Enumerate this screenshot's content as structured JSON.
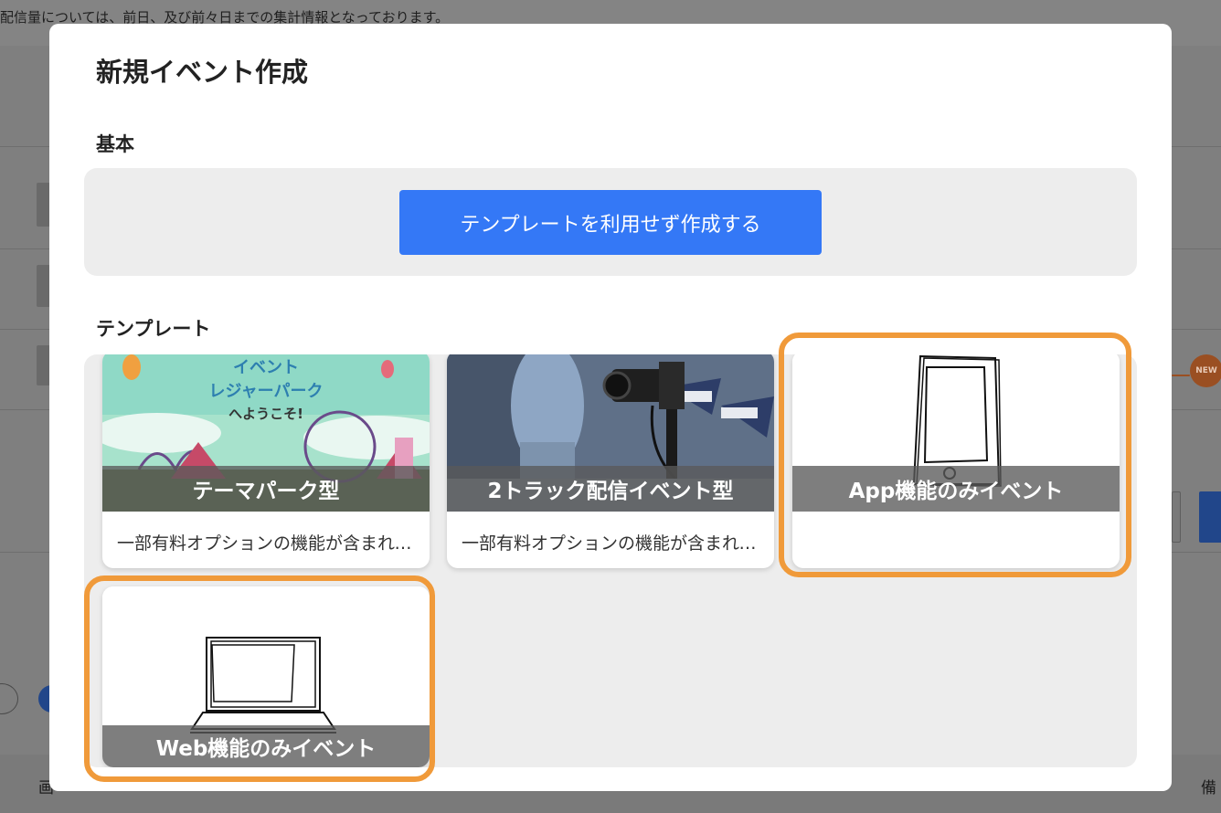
{
  "background": {
    "notice_text": "配信量については、前日、及び前々日までの集計情報となっております。",
    "new_badge": "NEW",
    "footer_labels": [
      "画",
      "備"
    ]
  },
  "modal": {
    "title": "新規イベント作成",
    "basic_section": {
      "title": "基本",
      "blank_button_label": "テンプレートを利用せず作成する"
    },
    "template_section": {
      "title": "テンプレート",
      "cards": [
        {
          "name": "テーマパーク型",
          "description": "一部有料オプションの機能が含まれています",
          "image_text": [
            "イベント",
            "レジャーパーク",
            "へようこそ!"
          ],
          "icon": "theme-park-illustration"
        },
        {
          "name": "2トラック配信イベント型",
          "description": "一部有料オプションの機能が含まれています",
          "icon": "video-camera-photo"
        },
        {
          "name": "App機能のみイベント",
          "description": "",
          "icon": "smartphone-icon"
        },
        {
          "name": "Web機能のみイベント",
          "description": "",
          "icon": "laptop-icon"
        }
      ]
    }
  },
  "colors": {
    "primary_button": "#3478f6",
    "highlight_outline": "#f09a3a",
    "overlay": "#7f7f7f"
  }
}
